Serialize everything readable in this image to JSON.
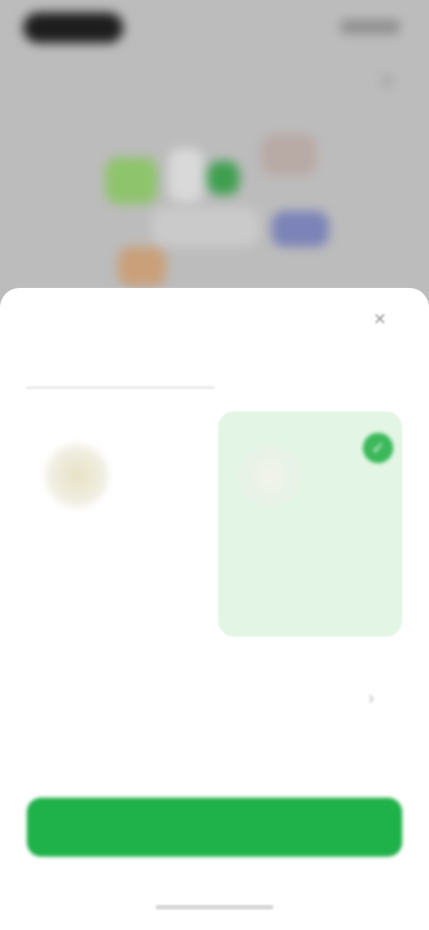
{
  "status_bar": {
    "time": "",
    "indicators": ""
  },
  "sheet": {
    "title": "",
    "close_icon": "close-icon"
  },
  "tabs": [
    {
      "label": "",
      "active": true
    },
    {
      "label": "",
      "active": false
    }
  ],
  "cards": [
    {
      "name": "",
      "description": "",
      "selected": false,
      "icon": "illustration-icon"
    },
    {
      "name": "",
      "description": "",
      "selected": true,
      "icon": "illustration-icon"
    }
  ],
  "option": {
    "label": "",
    "sublabel": "",
    "icon": "chevron-right-icon"
  },
  "primary_button": {
    "label": ""
  },
  "colors": {
    "accent": "#1fb14a",
    "selected_card_bg": "#e3f6e5",
    "check": "#3cb85a"
  }
}
